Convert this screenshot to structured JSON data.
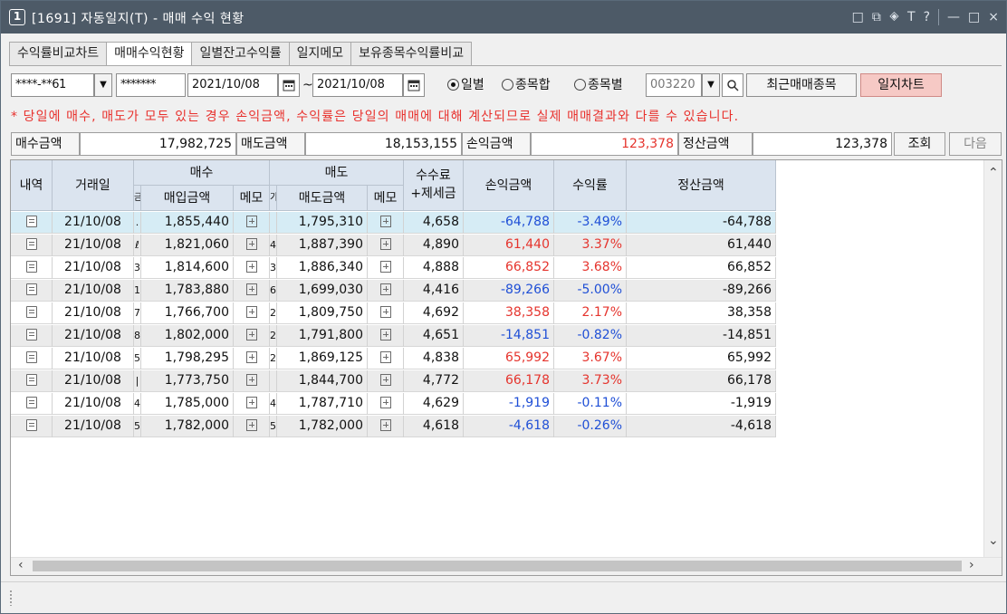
{
  "window": {
    "number_badge": "1",
    "title": "[1691] 자동일지(T) - 매매 수익 현황",
    "title_icons": [
      "□",
      "⧉",
      "🞛",
      "T",
      "?",
      "—",
      "□",
      "×"
    ]
  },
  "tabs": [
    {
      "label": "수익률비교차트",
      "active": false
    },
    {
      "label": "매매수익현황",
      "active": true
    },
    {
      "label": "일별잔고수익률",
      "active": false
    },
    {
      "label": "일지메모",
      "active": false
    },
    {
      "label": "보유종목수익률비교",
      "active": false
    }
  ],
  "filters": {
    "account": "****-**61",
    "password": "*******",
    "start_date": "2021/10/08",
    "date_sep": "~",
    "end_date": "2021/10/08",
    "radio_options": [
      {
        "label": "일별",
        "checked": true
      },
      {
        "label": "종목합",
        "checked": false
      },
      {
        "label": "종목별",
        "checked": false
      }
    ],
    "stock_code": "003220",
    "recent_button": "최근매매종목",
    "chart_button": "일지차트"
  },
  "notice": "* 당일에 매수, 매도가 모두 있는 경우 손익금액, 수익률은 당일의 매매에 대해 계산되므로 실제 매매결과와 다를 수 있습니다.",
  "summary": {
    "buy_label": "매수금액",
    "buy_value": "17,982,725",
    "sell_label": "매도금액",
    "sell_value": "18,153,155",
    "pl_label": "손익금액",
    "pl_value": "123,378",
    "settle_label": "정산금액",
    "settle_value": "123,378",
    "query_button": "조회",
    "next_button": "다음"
  },
  "grid": {
    "headers": {
      "detail": "내역",
      "date": "거래일",
      "buy_group": "매수",
      "sell_group": "매도",
      "buy_amount": "매입금액",
      "buy_memo": "메모",
      "sell_amount": "매도금액",
      "sell_memo": "메모",
      "fee_line1": "수수료",
      "fee_line2": "+제세금",
      "pl": "손익금액",
      "rate": "수익률",
      "settle": "정산금액",
      "buy_stub": "금",
      "sell_stub": "가"
    },
    "rows": [
      {
        "date": "21/10/08",
        "buy_stub": ".",
        "buy_amount": "1,855,440",
        "sell_stub": "",
        "sell_amount": "1,795,310",
        "fee": "4,658",
        "pl": "-64,788",
        "rate": "-3.49%",
        "settle": "-64,788",
        "sign": "neg"
      },
      {
        "date": "21/10/08",
        "buy_stub": "ℓ",
        "buy_amount": "1,821,060",
        "sell_stub": "4",
        "sell_amount": "1,887,390",
        "fee": "4,890",
        "pl": "61,440",
        "rate": "3.37%",
        "settle": "61,440",
        "sign": "pos"
      },
      {
        "date": "21/10/08",
        "buy_stub": "3",
        "buy_amount": "1,814,600",
        "sell_stub": "3",
        "sell_amount": "1,886,340",
        "fee": "4,888",
        "pl": "66,852",
        "rate": "3.68%",
        "settle": "66,852",
        "sign": "pos"
      },
      {
        "date": "21/10/08",
        "buy_stub": "1",
        "buy_amount": "1,783,880",
        "sell_stub": "6",
        "sell_amount": "1,699,030",
        "fee": "4,416",
        "pl": "-89,266",
        "rate": "-5.00%",
        "settle": "-89,266",
        "sign": "neg"
      },
      {
        "date": "21/10/08",
        "buy_stub": "7",
        "buy_amount": "1,766,700",
        "sell_stub": "2",
        "sell_amount": "1,809,750",
        "fee": "4,692",
        "pl": "38,358",
        "rate": "2.17%",
        "settle": "38,358",
        "sign": "pos"
      },
      {
        "date": "21/10/08",
        "buy_stub": "8",
        "buy_amount": "1,802,000",
        "sell_stub": "2",
        "sell_amount": "1,791,800",
        "fee": "4,651",
        "pl": "-14,851",
        "rate": "-0.82%",
        "settle": "-14,851",
        "sign": "neg"
      },
      {
        "date": "21/10/08",
        "buy_stub": "5",
        "buy_amount": "1,798,295",
        "sell_stub": "2",
        "sell_amount": "1,869,125",
        "fee": "4,838",
        "pl": "65,992",
        "rate": "3.67%",
        "settle": "65,992",
        "sign": "pos"
      },
      {
        "date": "21/10/08",
        "buy_stub": "|",
        "buy_amount": "1,773,750",
        "sell_stub": "",
        "sell_amount": "1,844,700",
        "fee": "4,772",
        "pl": "66,178",
        "rate": "3.73%",
        "settle": "66,178",
        "sign": "pos"
      },
      {
        "date": "21/10/08",
        "buy_stub": "4",
        "buy_amount": "1,785,000",
        "sell_stub": "4",
        "sell_amount": "1,787,710",
        "fee": "4,629",
        "pl": "-1,919",
        "rate": "-0.11%",
        "settle": "-1,919",
        "sign": "neg"
      },
      {
        "date": "21/10/08",
        "buy_stub": "5",
        "buy_amount": "1,782,000",
        "sell_stub": "5",
        "sell_amount": "1,782,000",
        "fee": "4,618",
        "pl": "-4,618",
        "rate": "-0.26%",
        "settle": "-4,618",
        "sign": "neg"
      }
    ],
    "selected_row": 0
  },
  "colors": {
    "positive": "#e5342d",
    "negative": "#1f4fd6",
    "header_bg": "#dbe4ef",
    "titlebar_bg": "#4d5a67",
    "selected_row": "#d6ecf5"
  },
  "icons": {
    "detail": "document-icon",
    "memo": "memo-add-icon",
    "calendar": "calendar-icon",
    "search": "search-icon",
    "dropdown": "chevron-down-icon"
  }
}
